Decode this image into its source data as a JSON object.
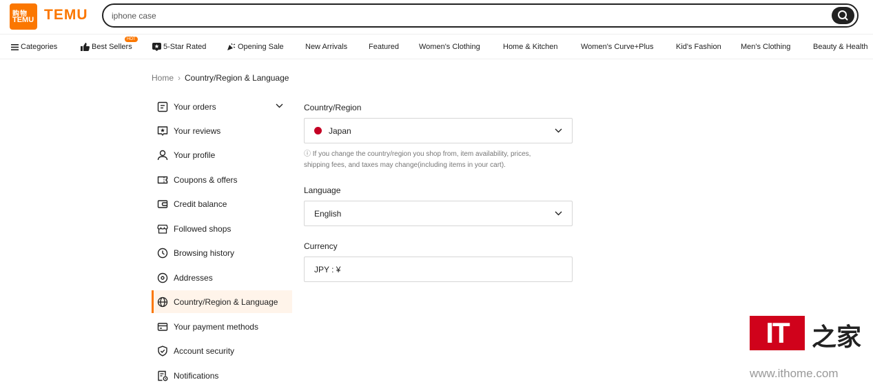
{
  "header": {
    "logo_line1": "购物",
    "logo_line2": "TEMU",
    "brand": "TEMU",
    "search_value": "iphone case"
  },
  "nav": {
    "categories": "Categories",
    "best_sellers": "Best Sellers",
    "hot_badge": "HOT",
    "five_star": "5-Star Rated",
    "opening_sale": "Opening Sale",
    "new_arrivals": "New Arrivals",
    "featured": "Featured",
    "womens_clothing": "Women's Clothing",
    "home_kitchen": "Home & Kitchen",
    "womens_curve": "Women's Curve+Plus",
    "kids_fashion": "Kid's Fashion",
    "mens_clothing": "Men's Clothing",
    "beauty_health": "Beauty & Health"
  },
  "breadcrumb": {
    "home": "Home",
    "separator": "›",
    "current": "Country/Region & Language"
  },
  "sidebar": {
    "items": [
      {
        "label": "Your orders",
        "icon": "orders-icon"
      },
      {
        "label": "Your reviews",
        "icon": "reviews-icon"
      },
      {
        "label": "Your profile",
        "icon": "profile-icon"
      },
      {
        "label": "Coupons & offers",
        "icon": "coupon-icon"
      },
      {
        "label": "Credit balance",
        "icon": "wallet-icon"
      },
      {
        "label": "Followed shops",
        "icon": "shop-icon"
      },
      {
        "label": "Browsing history",
        "icon": "clock-icon"
      },
      {
        "label": "Addresses",
        "icon": "location-icon"
      },
      {
        "label": "Country/Region & Language",
        "icon": "globe-icon"
      },
      {
        "label": "Your payment methods",
        "icon": "card-icon"
      },
      {
        "label": "Account security",
        "icon": "shield-icon"
      },
      {
        "label": "Notifications",
        "icon": "notifications-icon"
      }
    ],
    "active_index": 8
  },
  "form": {
    "country_label": "Country/Region",
    "country_value": "Japan",
    "country_flag_color": "#c40024",
    "hint_line1": "ⓘ If you change the country/region you shop from, item availability, prices,",
    "hint_line2": "shipping fees, and taxes may change(including items in your cart).",
    "language_label": "Language",
    "language_value": "English",
    "currency_label": "Currency",
    "currency_value": "JPY : ¥"
  },
  "watermark": {
    "logo": "IT",
    "chinese": "之家",
    "url": "www.ithome.com"
  },
  "colors": {
    "accent": "#fb7701",
    "active_bg": "#fff4ea"
  }
}
